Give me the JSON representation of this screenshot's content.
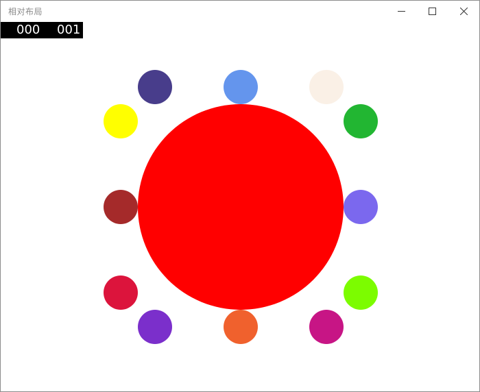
{
  "window": {
    "title": "相对布局"
  },
  "counter": {
    "first": "000",
    "second": "001"
  },
  "center_circle": {
    "color": "#ff0000"
  },
  "dots": [
    {
      "name": "dot-darkslateblue",
      "color": "#483d8b"
    },
    {
      "name": "dot-cornflowerblue",
      "color": "#6495ed"
    },
    {
      "name": "dot-linen",
      "color": "#faf0e6"
    },
    {
      "name": "dot-yellow",
      "color": "#ffff00"
    },
    {
      "name": "dot-green",
      "color": "#22b632"
    },
    {
      "name": "dot-brown",
      "color": "#a52a2a"
    },
    {
      "name": "dot-mediumslateblue",
      "color": "#7b68ee"
    },
    {
      "name": "dot-crimson",
      "color": "#dc143c"
    },
    {
      "name": "dot-lawngreen",
      "color": "#7cfc00"
    },
    {
      "name": "dot-blueviolet",
      "color": "#7b2fcb"
    },
    {
      "name": "dot-orange",
      "color": "#f0612d"
    },
    {
      "name": "dot-mediumvioletred",
      "color": "#c71585"
    }
  ]
}
